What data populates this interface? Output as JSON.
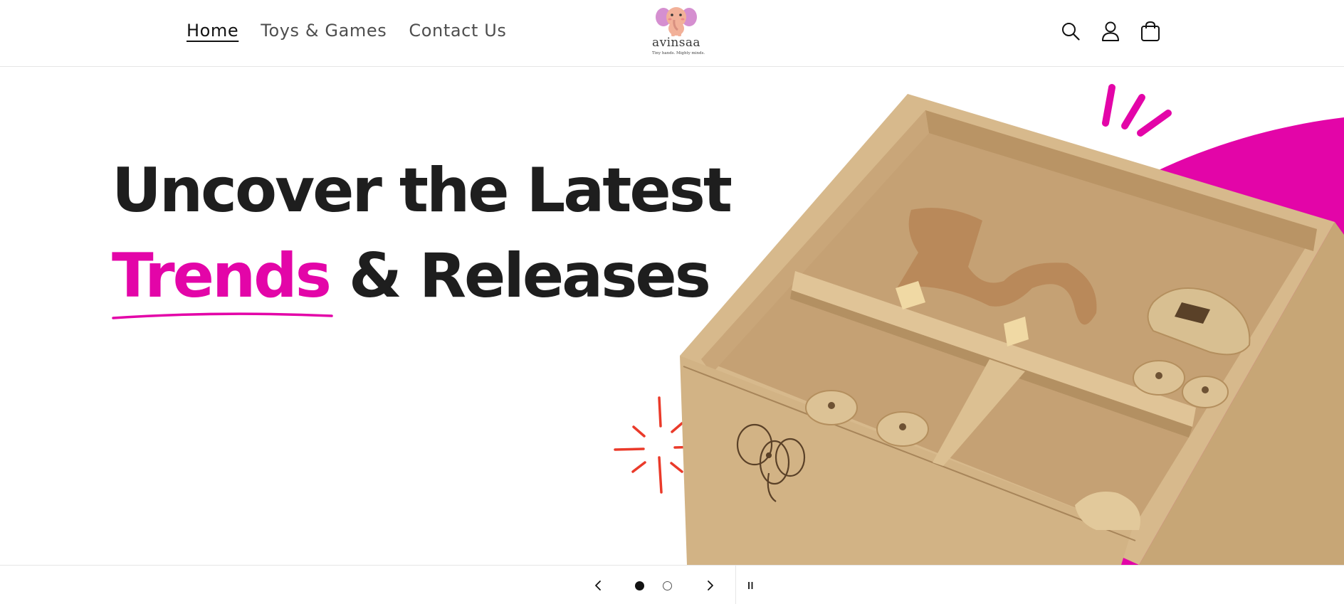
{
  "header": {
    "nav": [
      {
        "label": "Home",
        "active": true
      },
      {
        "label": "Toys & Games",
        "active": false
      },
      {
        "label": "Contact Us",
        "active": false
      }
    ],
    "logo": {
      "name": "avinsaa",
      "tagline": "Tiny hands. Mighty minds."
    },
    "icons": [
      "search-icon",
      "account-icon",
      "cart-icon"
    ]
  },
  "hero": {
    "headline_line1": "Uncover the Latest",
    "headline_accent": "Trends",
    "headline_rest": " & Releases",
    "accent_color": "#e305a8",
    "box_brand_mark": "avi"
  },
  "slideshow": {
    "slide_count": 2,
    "current_slide": 1,
    "previous_icon": "chevron-left-icon",
    "next_icon": "chevron-right-icon",
    "pause_icon": "pause-icon"
  }
}
